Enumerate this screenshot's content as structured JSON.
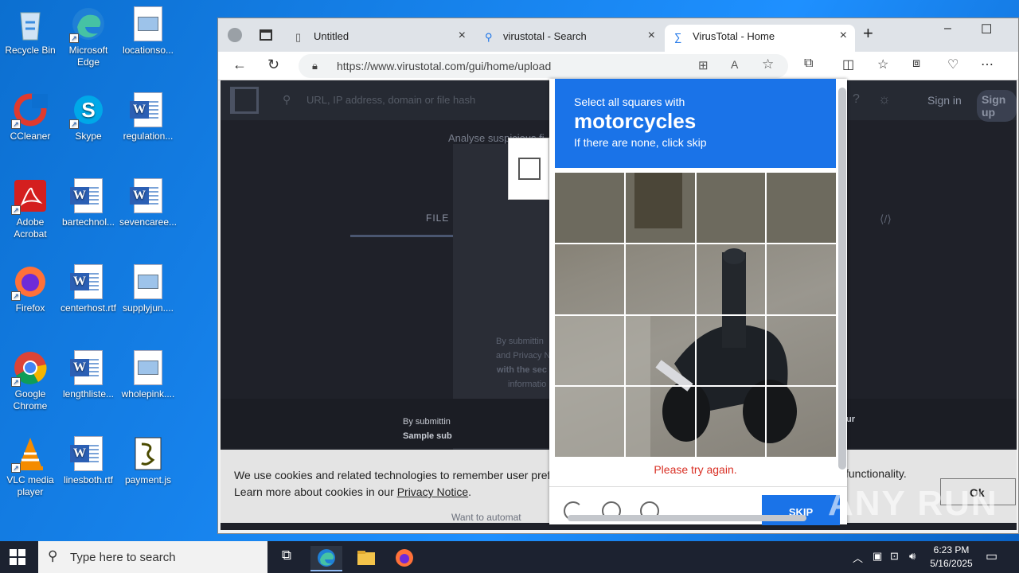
{
  "desktop": {
    "icons": [
      {
        "label": "Recycle Bin",
        "icon": "recycle-bin-icon"
      },
      {
        "label": "Microsoft Edge",
        "icon": "edge-icon"
      },
      {
        "label": "locationso...",
        "icon": "image-file-icon"
      },
      {
        "label": "CCleaner",
        "icon": "ccleaner-icon"
      },
      {
        "label": "Skype",
        "icon": "skype-icon"
      },
      {
        "label": "regulation...",
        "icon": "word-doc-icon"
      },
      {
        "label": "Adobe Acrobat",
        "icon": "acrobat-icon"
      },
      {
        "label": "bartechnol...",
        "icon": "word-doc-icon"
      },
      {
        "label": "sevencaree...",
        "icon": "word-doc-icon"
      },
      {
        "label": "Firefox",
        "icon": "firefox-icon"
      },
      {
        "label": "centerhost.rtf",
        "icon": "word-doc-icon"
      },
      {
        "label": "supplyjun....",
        "icon": "image-file-icon"
      },
      {
        "label": "Google Chrome",
        "icon": "chrome-icon"
      },
      {
        "label": "lengthliste...",
        "icon": "word-doc-icon"
      },
      {
        "label": "wholepink....",
        "icon": "image-file-icon"
      },
      {
        "label": "VLC media player",
        "icon": "vlc-icon"
      },
      {
        "label": "linesboth.rtf",
        "icon": "word-doc-icon"
      },
      {
        "label": "payment.js",
        "icon": "script-file-icon"
      }
    ]
  },
  "browser": {
    "tabs": [
      {
        "label": "Untitled"
      },
      {
        "label": "virustotal - Search"
      },
      {
        "label": "VirusTotal - Home"
      }
    ],
    "url": "https://www.virustotal.com/gui/home/upload"
  },
  "page": {
    "search_placeholder": "URL, IP address, domain or file hash",
    "sign_in": "Sign in",
    "sign_up": "Sign up",
    "analyse": "Analyse suspicious fi",
    "file_tab": "FILE",
    "by_submitting_1": "By submittin",
    "and_privacy": "and Privacy N",
    "with_sec": "with the sec",
    "information": "informatio",
    "footer_by": "By submittin",
    "footer_sample": "Sample sub",
    "footer_right_1": "ur",
    "cookie_text": "We use cookies and related technologies to remember user prefer",
    "cookie_text_cont": "functionality.",
    "cookie_text_2": "Learn more about cookies in our ",
    "privacy_notice": "Privacy Notice",
    "privacy_period": ".",
    "ok": "Ok",
    "want_automate": "Want to automat"
  },
  "captcha": {
    "line1": "Select all squares with",
    "line2": "motorcycles",
    "line3": "If there are none, click skip",
    "error": "Please try again.",
    "skip": "SKIP"
  },
  "watermark": "ANY RUN",
  "taskbar": {
    "search_placeholder": "Type here to search",
    "time": "6:23 PM",
    "date": "5/16/2025"
  },
  "colors": {
    "accent": "#1a73e8",
    "error": "#d93025",
    "desktop": "#0c6fd0"
  }
}
